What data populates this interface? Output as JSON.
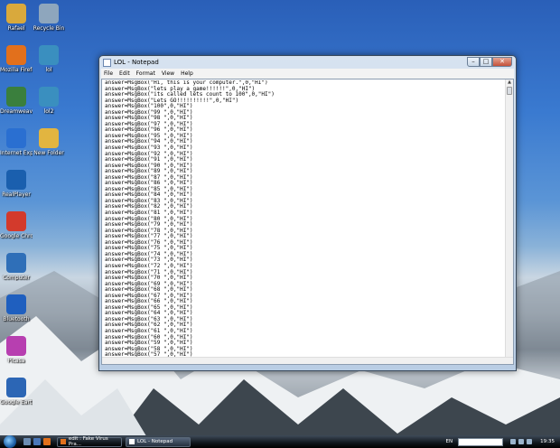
{
  "desktop": {
    "icons_left": [
      {
        "label": "Rafael",
        "icon": "user-folder-icon",
        "color": "#d9a93c"
      },
      {
        "label": "Mozilla Firefox",
        "icon": "firefox-icon",
        "color": "#e2701c"
      },
      {
        "label": "Dreamweaver",
        "icon": "dreamweaver-icon",
        "color": "#3a7f3d"
      },
      {
        "label": "Internet Explorer",
        "icon": "internet-explorer-icon",
        "color": "#2a6fd1"
      },
      {
        "label": "RealPlayer",
        "icon": "realplayer-icon",
        "color": "#1a5fae"
      },
      {
        "label": "Google Chrome",
        "icon": "chrome-icon",
        "color": "#d33a2c"
      },
      {
        "label": "Computer",
        "icon": "computer-icon",
        "color": "#2f6fb8"
      },
      {
        "label": "Bluetooth",
        "icon": "bluetooth-icon",
        "color": "#1f5fbf"
      },
      {
        "label": "Picasa",
        "icon": "picasa-icon",
        "color": "#b73fb0"
      },
      {
        "label": "Google Earth",
        "icon": "google-earth-icon",
        "color": "#2c66b5"
      }
    ],
    "icons_right": [
      {
        "label": "Recycle Bin",
        "icon": "recycle-bin-icon",
        "color": "#8ea6bd"
      },
      {
        "label": "lol",
        "icon": "script-file-icon",
        "color": "#3a8fbf"
      },
      {
        "label": "lol2",
        "icon": "script-file-icon",
        "color": "#3a8fbf"
      },
      {
        "label": "New Folder",
        "icon": "folder-icon",
        "color": "#e2b540"
      }
    ]
  },
  "window": {
    "title": "LOL - Notepad",
    "menu": [
      "File",
      "Edit",
      "Format",
      "View",
      "Help"
    ],
    "minimize_glyph": "–",
    "maximize_glyph": "□",
    "close_glyph": "✕",
    "lines": [
      "answer=MsgBox(\"Hi, this is your computer.\",0,\"HI\")",
      "answer=MsgBox(\"lets play a game!!!!!!\",0,\"HI\")",
      "answer=MsgBox(\"its called lets count to 100\",0,\"HI\")",
      "answer=MsgBox(\"Lets GO!!!!!!!!!!\",0,\"HI\")",
      "answer=MsgBox(\"100\",0,\"HI\")",
      "answer=MsgBox(\"99 \",0,\"HI\")",
      "answer=MsgBox(\"98 \",0,\"HI\")",
      "answer=MsgBox(\"97 \",0,\"HI\")",
      "answer=MsgBox(\"96 \",0,\"HI\")",
      "answer=MsgBox(\"95 \",0,\"HI\")",
      "answer=MsgBox(\"94 \",0,\"HI\")",
      "answer=MsgBox(\"93 \",0,\"HI\")",
      "answer=MsgBox(\"92 \",0,\"HI\")",
      "answer=MsgBox(\"91 \",0,\"HI\")",
      "answer=MsgBox(\"90 \",0,\"HI\")",
      "answer=MsgBox(\"89 \",0,\"HI\")",
      "answer=MsgBox(\"87 \",0,\"HI\")",
      "answer=MsgBox(\"86 \",0,\"HI\")",
      "answer=MsgBox(\"85 \",0,\"HI\")",
      "answer=MsgBox(\"84 \",0,\"HI\")",
      "answer=MsgBox(\"83 \",0,\"HI\")",
      "answer=MsgBox(\"82 \",0,\"HI\")",
      "answer=MsgBox(\"81 \",0,\"HI\")",
      "answer=MsgBox(\"80 \",0,\"HI\")",
      "answer=MsgBox(\"79 \",0,\"HI\")",
      "answer=MsgBox(\"78 \",0,\"HI\")",
      "answer=MsgBox(\"77 \",0,\"HI\")",
      "answer=MsgBox(\"76 \",0,\"HI\")",
      "answer=MsgBox(\"75 \",0,\"HI\")",
      "answer=MsgBox(\"74 \",0,\"HI\")",
      "answer=MsgBox(\"73 \",0,\"HI\")",
      "answer=MsgBox(\"72 \",0,\"HI\")",
      "answer=MsgBox(\"71 \",0,\"HI\")",
      "answer=MsgBox(\"70 \",0,\"HI\")",
      "answer=MsgBox(\"69 \",0,\"HI\")",
      "answer=MsgBox(\"68 \",0,\"HI\")",
      "answer=MsgBox(\"67 \",0,\"HI\")",
      "answer=MsgBox(\"66 \",0,\"HI\")",
      "answer=MsgBox(\"65 \",0,\"HI\")",
      "answer=MsgBox(\"64 \",0,\"HI\")",
      "answer=MsgBox(\"63 \",0,\"HI\")",
      "answer=MsgBox(\"62 \",0,\"HI\")",
      "answer=MsgBox(\"61 \",0,\"HI\")",
      "answer=MsgBox(\"60 \",0,\"HI\")",
      "answer=MsgBox(\"59 \",0,\"HI\")",
      "answer=MsgBox(\"58 \",0,\"HI\")",
      "answer=MsgBox(\"57 \",0,\"HI\")",
      "answer=MsgBox(\"56 \",0,\"HI\")",
      "answer=MsgBox(\"55 \",0,\"HI\")"
    ]
  },
  "taskbar": {
    "tasks": [
      {
        "label": "edit : Fake Virus Pra...",
        "icon": "firefox-icon",
        "active": false
      },
      {
        "label": "LOL - Notepad",
        "icon": "notepad-icon",
        "active": true
      }
    ],
    "language": "EN",
    "clock": "19:35"
  }
}
